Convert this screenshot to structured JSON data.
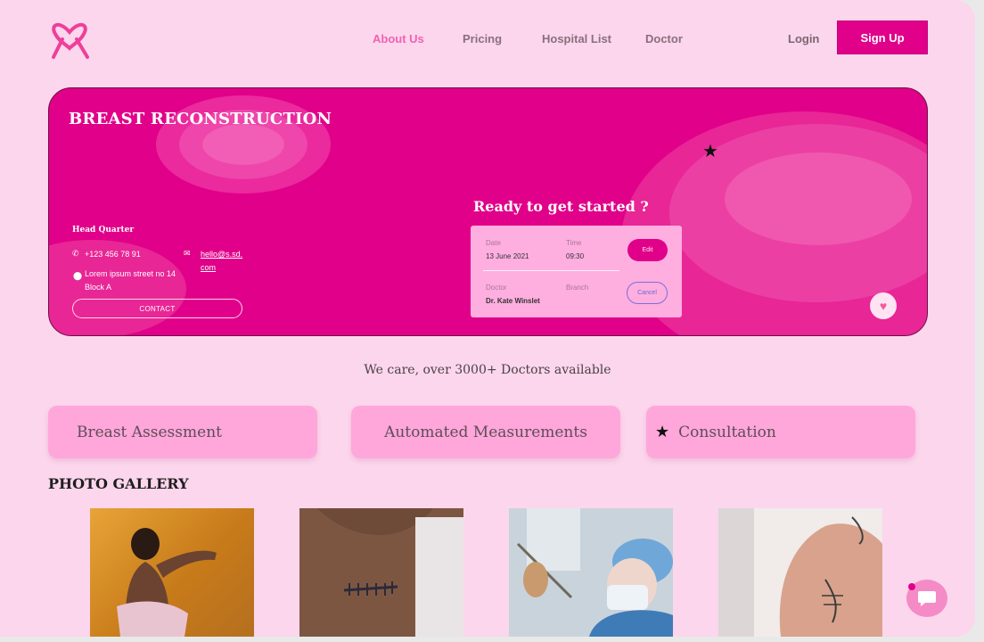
{
  "nav": {
    "items": [
      {
        "label": "About Us",
        "active": true
      },
      {
        "label": "Pricing"
      },
      {
        "label": "Hospital List"
      },
      {
        "label": "Doctor"
      }
    ],
    "login_label": "Login",
    "signup_label": "Sign Up"
  },
  "hero": {
    "title": "BREAST RECONSTRUCTION",
    "hq": {
      "heading": "Head Quarter",
      "phone": "+123 456 78 91",
      "email_line1": "hello@s.sd.",
      "email_line2": "com",
      "address_line1": "Lorem ipsum street no 14",
      "address_line2": "Block A",
      "contact_label": "CONTACT"
    },
    "booking": {
      "heading": "Ready to get started ?",
      "date_label": "Date",
      "date_value": "13 June 2021",
      "time_label": "Time",
      "time_value": "09:30",
      "doctor_label": "Doctor",
      "doctor_value": "Dr. Kate Winslet",
      "branch_label": "Branch",
      "edit_label": "Edit",
      "cancel_label": "Cancel"
    }
  },
  "tagline": "We care, over 3000+ Doctors available",
  "services": [
    {
      "label": "Breast Assessment"
    },
    {
      "label": "Automated Measurements"
    },
    {
      "label": "Consultation",
      "icon": "star-icon"
    }
  ],
  "gallery": {
    "title": "PHOTO GALLERY",
    "photos": [
      "gallery-photo-1",
      "gallery-photo-2",
      "gallery-photo-3",
      "gallery-photo-4"
    ]
  },
  "colors": {
    "background": "#fcd6ec",
    "brand": "#e0008a",
    "card": "#ffa6da",
    "active_nav": "#f062b3"
  }
}
